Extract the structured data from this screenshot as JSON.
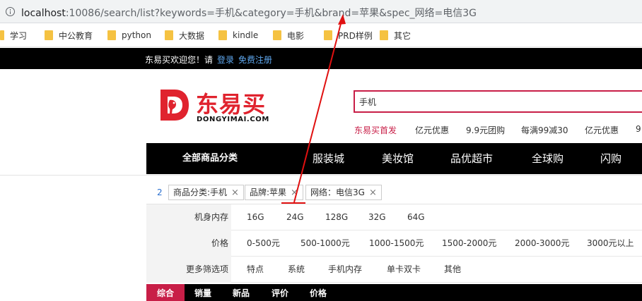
{
  "address_bar": {
    "host": "localhost",
    "path": ":10086/search/list?keywords=手机&category=手机&brand=苹果&spec_网络=电信3G"
  },
  "bookmarks": [
    "学习",
    "中公教育",
    "python",
    "大数据",
    "kindle",
    "电影",
    "PRD样例",
    "其它"
  ],
  "topbar": {
    "welcome": "东易买欢迎您！请",
    "login": "登录",
    "register": "免费注册"
  },
  "logo": {
    "name": "东易买",
    "sub": "DONGYIMAI.COM"
  },
  "search": {
    "value": "手机"
  },
  "hotlinks": [
    "东易买首发",
    "亿元优惠",
    "9.9元团购",
    "每满99减30",
    "亿元优惠",
    "9"
  ],
  "nav": {
    "all": "全部商品分类",
    "items": [
      "服装城",
      "美妆馆",
      "品优超市",
      "全球购",
      "闪购"
    ]
  },
  "breadcrumb": {
    "num": "2",
    "chips": [
      "商品分类:手机",
      "品牌:苹果",
      "网络：电信3G"
    ],
    "close": "×"
  },
  "filters": [
    {
      "label": "机身内存",
      "options": [
        "16G",
        "24G",
        "128G",
        "32G",
        "64G"
      ]
    },
    {
      "label": "价格",
      "options": [
        "0-500元",
        "500-1000元",
        "1000-1500元",
        "1500-2000元",
        "2000-3000元",
        "3000元以上"
      ]
    },
    {
      "label": "更多筛选项",
      "options": [
        "特点",
        "系统",
        "手机内存",
        "单卡双卡",
        "其他"
      ]
    }
  ],
  "sort": [
    "综合",
    "销量",
    "新品",
    "评价",
    "价格"
  ],
  "colors": {
    "brand_red": "#e0232e",
    "accent": "#c81e47",
    "annotation_red": "#e01010"
  }
}
